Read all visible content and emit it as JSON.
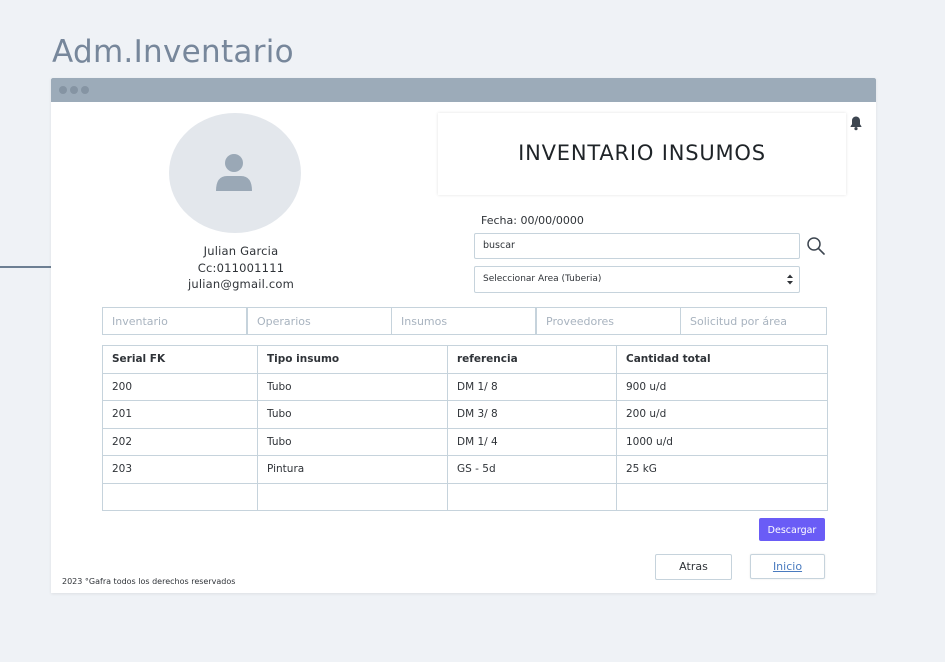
{
  "page_title": "Adm.Inventario",
  "user": {
    "name": "Julian Garcia",
    "id": "Cc:011001111",
    "email": "julian@gmail.com"
  },
  "heading": "INVENTARIO INSUMOS",
  "date_label": "Fecha: 00/00/0000",
  "search": {
    "value": "buscar"
  },
  "area_select": {
    "selected": "Seleccionar Area (Tuberia)"
  },
  "tabs": [
    {
      "label": "Inventario"
    },
    {
      "label": "Operarios"
    },
    {
      "label": "Insumos"
    },
    {
      "label": "Proveedores"
    },
    {
      "label": "Solicitud por área"
    }
  ],
  "table": {
    "headers": [
      "Serial FK",
      "Tipo insumo",
      "referencia",
      "Cantidad total"
    ],
    "rows": [
      [
        "200",
        "Tubo",
        "DM  1/ 8",
        "900 u/d"
      ],
      [
        "201",
        "Tubo",
        "DM  3/ 8",
        "200 u/d"
      ],
      [
        "202",
        "Tubo",
        "DM  1/ 4",
        "1000 u/d"
      ],
      [
        "203",
        "Pintura",
        "GS - 5d",
        "25 kG"
      ],
      [
        "",
        "",
        "",
        ""
      ]
    ]
  },
  "buttons": {
    "download": "Descargar",
    "back": "Atras",
    "home": "Inicio"
  },
  "footer": "2023 °Gafra todos los derechos reservados",
  "colors": {
    "accent": "#6a5cf6",
    "titlebar": "#9cabb9",
    "link": "#4a7bbf"
  },
  "icons": [
    "user-icon",
    "bell-icon",
    "search-icon",
    "select-arrows-icon"
  ]
}
